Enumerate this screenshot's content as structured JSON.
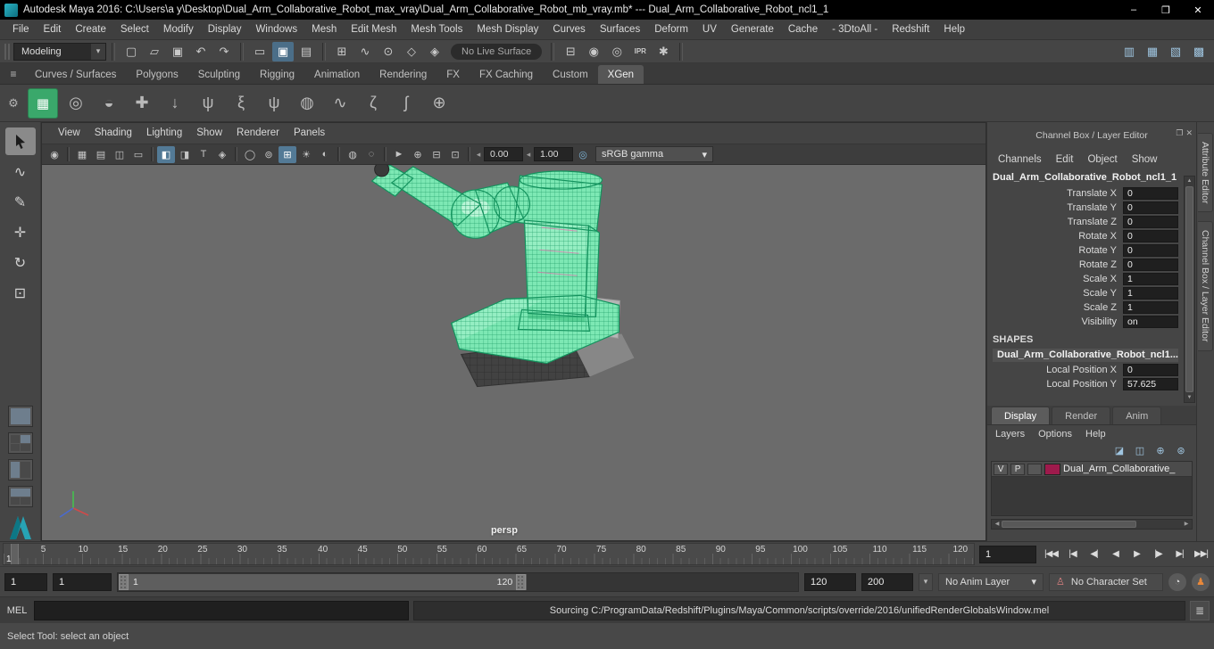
{
  "window": {
    "title": "Autodesk Maya 2016: C:\\Users\\a y\\Desktop\\Dual_Arm_Collaborative_Robot_max_vray\\Dual_Arm_Collaborative_Robot_mb_vray.mb*   ---   Dual_Arm_Collaborative_Robot_ncl1_1"
  },
  "menubar": {
    "items": [
      "File",
      "Edit",
      "Create",
      "Select",
      "Modify",
      "Display",
      "Windows",
      "Mesh",
      "Edit Mesh",
      "Mesh Tools",
      "Mesh Display",
      "Curves",
      "Surfaces",
      "Deform",
      "UV",
      "Generate",
      "Cache",
      "- 3DtoAll -",
      "Redshift",
      "Help"
    ]
  },
  "statusline": {
    "menuset": "Modeling",
    "live_surface": "No Live Surface"
  },
  "shelf": {
    "tabs": [
      "Curves / Surfaces",
      "Polygons",
      "Sculpting",
      "Rigging",
      "Animation",
      "Rendering",
      "FX",
      "FX Caching",
      "Custom",
      "XGen"
    ],
    "active_tab": "XGen"
  },
  "viewport": {
    "menus": [
      "View",
      "Shading",
      "Lighting",
      "Show",
      "Renderer",
      "Panels"
    ],
    "exposure": "0.00",
    "gamma": "1.00",
    "view_transform": "sRGB gamma",
    "camera": "persp"
  },
  "channel_box": {
    "panel_title": "Channel Box / Layer Editor",
    "menus": [
      "Channels",
      "Edit",
      "Object",
      "Show"
    ],
    "object_name": "Dual_Arm_Collaborative_Robot_ncl1_1",
    "attributes": [
      {
        "label": "Translate X",
        "value": "0"
      },
      {
        "label": "Translate Y",
        "value": "0"
      },
      {
        "label": "Translate Z",
        "value": "0"
      },
      {
        "label": "Rotate X",
        "value": "0"
      },
      {
        "label": "Rotate Y",
        "value": "0"
      },
      {
        "label": "Rotate Z",
        "value": "0"
      },
      {
        "label": "Scale X",
        "value": "1"
      },
      {
        "label": "Scale Y",
        "value": "1"
      },
      {
        "label": "Scale Z",
        "value": "1"
      },
      {
        "label": "Visibility",
        "value": "on"
      }
    ],
    "shapes_header": "SHAPES",
    "shape_name": "Dual_Arm_Collaborative_Robot_ncl1...",
    "shape_attributes": [
      {
        "label": "Local Position X",
        "value": "0"
      },
      {
        "label": "Local Position Y",
        "value": "57.625"
      }
    ]
  },
  "layer_editor": {
    "tabs": [
      "Display",
      "Render",
      "Anim"
    ],
    "active_tab": "Display",
    "menus": [
      "Layers",
      "Options",
      "Help"
    ],
    "layer": {
      "visible": "V",
      "playback": "P",
      "name": "Dual_Arm_Collaborative_",
      "swatch_color": "#9e1a4c"
    }
  },
  "side_tabs": [
    "Attribute Editor",
    "Channel Box / Layer Editor"
  ],
  "timeline": {
    "ticks": [
      "5",
      "10",
      "15",
      "20",
      "25",
      "30",
      "35",
      "40",
      "45",
      "50",
      "55",
      "60",
      "65",
      "70",
      "75",
      "80",
      "85",
      "90",
      "95",
      "100",
      "105",
      "110",
      "115",
      "120"
    ],
    "playhead_frame": "1",
    "current_frame": "1"
  },
  "range": {
    "anim_start": "1",
    "playback_start": "1",
    "bar_labels": [
      "1",
      "120"
    ],
    "playback_end": "120",
    "anim_end": "200",
    "anim_layer": "No Anim Layer",
    "character_set": "No Character Set"
  },
  "playback": {
    "buttons": [
      "|◀◀",
      "|◀",
      "◀|",
      "◀",
      "▶",
      "|▶",
      "▶|",
      "▶▶|"
    ]
  },
  "command_line": {
    "label": "MEL",
    "result": "Sourcing C:/ProgramData/Redshift/Plugins/Maya/Common/scripts/override/2016/unifiedRenderGlobalsWindow.mel"
  },
  "help_line": {
    "text": "Select Tool: select an object"
  },
  "colors": {
    "viewport_bg": "#6b6b6b",
    "selection_green": "#7de8b4",
    "layer_swatch": "#9e1a4c"
  },
  "icons": {
    "dd_arrow": "▾",
    "window": {
      "minimize": "–",
      "maximize": "❐",
      "close": "✕"
    },
    "file": [
      "▢",
      "▱",
      "▣"
    ],
    "undo_redo": [
      "↶",
      "↷"
    ],
    "masks": [
      "▭",
      "▣",
      "▤"
    ],
    "snap": [
      "⊞",
      "∿",
      "⊙",
      "◇",
      "◈"
    ],
    "render": [
      "⊟",
      "◉",
      "◎",
      "IPR",
      "✱"
    ],
    "panel_toggles": [
      "▥",
      "▦",
      "▧",
      "▩"
    ],
    "shelf_controls": [
      "≡",
      "⚙"
    ],
    "shelf_items": [
      "▦",
      "◎",
      "◒",
      "✚",
      "↓",
      "ψ",
      "ξ",
      "ψ",
      "◍",
      "∿",
      "ζ",
      "ʃ",
      "⊕"
    ],
    "tools": [
      "∿",
      "✎",
      "✛",
      "↻",
      "⊡"
    ],
    "vp": [
      "◉",
      "▦",
      "▤",
      "◫",
      "▭",
      "◧",
      "◨",
      "T",
      "◈",
      "◯",
      "⊚",
      "⊞",
      "☀",
      "◐",
      "◍",
      "◌",
      "►",
      "⊕",
      "⊟",
      "⊡"
    ],
    "vp_reset": "◂",
    "vp_srgb": "◎",
    "cb_window": [
      "❐",
      "✕"
    ],
    "le_row": [
      "◪",
      "◫",
      "⊕",
      "⊛"
    ],
    "scroll": {
      "up": "▲",
      "down": "▼",
      "left": "◀",
      "right": "▶"
    },
    "round": [
      "◔",
      "♟"
    ],
    "charset": "♙",
    "cmd": "≣"
  }
}
